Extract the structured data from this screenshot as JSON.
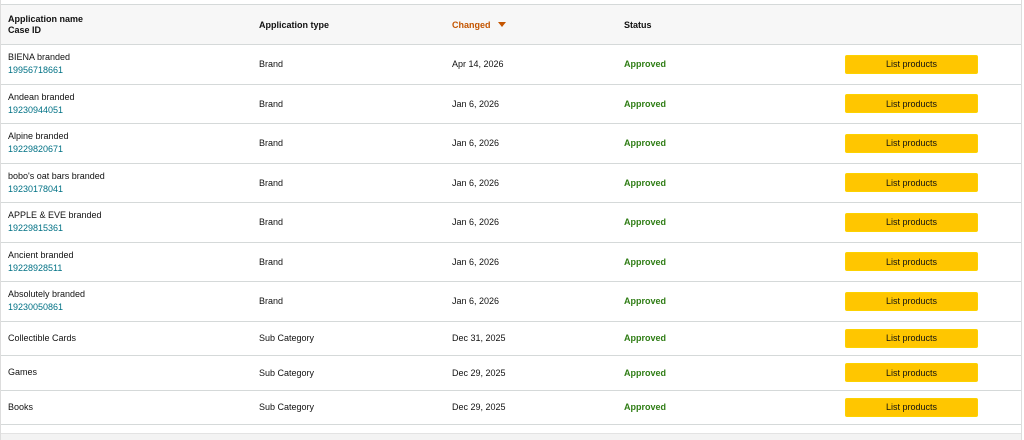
{
  "table": {
    "headers": {
      "name": "Application name",
      "case_id": "Case ID",
      "type": "Application type",
      "changed": "Changed",
      "status": "Status"
    },
    "sort": {
      "column": "Changed",
      "direction": "descending",
      "icon": "caret-down-icon"
    },
    "rows": [
      {
        "name": "BIENA branded",
        "case_id": "19956718661",
        "type": "Brand",
        "changed": "Apr 14, 2026",
        "status": "Approved",
        "action": "List products"
      },
      {
        "name": "Andean branded",
        "case_id": "19230944051",
        "type": "Brand",
        "changed": "Jan 6, 2026",
        "status": "Approved",
        "action": "List products"
      },
      {
        "name": "Alpine branded",
        "case_id": "19229820671",
        "type": "Brand",
        "changed": "Jan 6, 2026",
        "status": "Approved",
        "action": "List products"
      },
      {
        "name": "bobo's oat bars branded",
        "case_id": "19230178041",
        "type": "Brand",
        "changed": "Jan 6, 2026",
        "status": "Approved",
        "action": "List products"
      },
      {
        "name": "APPLE & EVE branded",
        "case_id": "19229815361",
        "type": "Brand",
        "changed": "Jan 6, 2026",
        "status": "Approved",
        "action": "List products"
      },
      {
        "name": "Ancient branded",
        "case_id": "19228928511",
        "type": "Brand",
        "changed": "Jan 6, 2026",
        "status": "Approved",
        "action": "List products"
      },
      {
        "name": "Absolutely branded",
        "case_id": "19230050861",
        "type": "Brand",
        "changed": "Jan 6, 2026",
        "status": "Approved",
        "action": "List products"
      },
      {
        "name": "Collectible Cards",
        "type": "Sub Category",
        "changed": "Dec 31, 2025",
        "status": "Approved",
        "action": "List products"
      },
      {
        "name": "Games",
        "type": "Sub Category",
        "changed": "Dec 29, 2025",
        "status": "Approved",
        "action": "List products"
      },
      {
        "name": "Books",
        "type": "Sub Category",
        "changed": "Dec 29, 2025",
        "status": "Approved",
        "action": "List products"
      }
    ]
  },
  "colors": {
    "accent_sort": "#c45500",
    "status_approved": "#2f7d15",
    "link": "#007185",
    "button": "#ffc600"
  }
}
